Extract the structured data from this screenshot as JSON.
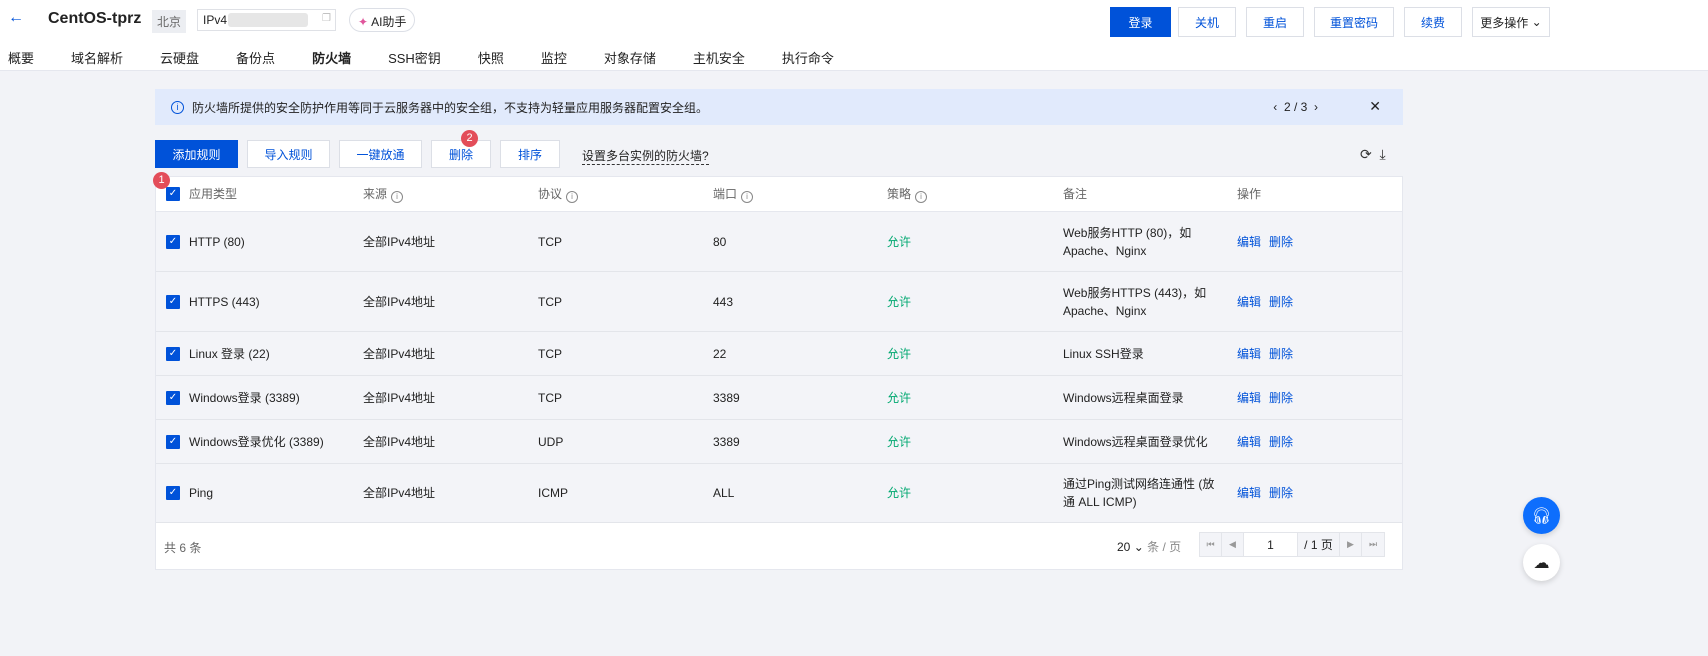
{
  "header": {
    "title": "CentOS-tprz",
    "region": "北京",
    "ip_label": "IPv4",
    "ai_label": "AI助手",
    "buttons": {
      "login": "登录",
      "shutdown": "关机",
      "restart": "重启",
      "reset_password": "重置密码",
      "renew": "续费",
      "more": "更多操作"
    }
  },
  "tabs": [
    "概要",
    "域名解析",
    "云硬盘",
    "备份点",
    "防火墙",
    "SSH密钥",
    "快照",
    "监控",
    "对象存储",
    "主机安全",
    "执行命令"
  ],
  "notice": {
    "text": "防火墙所提供的安全防护作用等同于云服务器中的安全组，不支持为轻量应用服务器配置安全组。",
    "pager": "2 / 3"
  },
  "toolbar": {
    "add": "添加规则",
    "import": "导入规则",
    "open_all": "一键放通",
    "delete": "删除",
    "sort": "排序",
    "multi_instance": "设置多台实例的防火墙?"
  },
  "badges": {
    "one": "1",
    "two": "2"
  },
  "table": {
    "headers": [
      "应用类型",
      "来源",
      "协议",
      "端口",
      "策略",
      "备注",
      "操作"
    ],
    "rows": [
      {
        "app": "HTTP (80)",
        "source": "全部IPv4地址",
        "protocol": "TCP",
        "port": "80",
        "policy": "允许",
        "note": "Web服务HTTP (80)，如 Apache、Nginx"
      },
      {
        "app": "HTTPS (443)",
        "source": "全部IPv4地址",
        "protocol": "TCP",
        "port": "443",
        "policy": "允许",
        "note": "Web服务HTTPS (443)，如 Apache、Nginx"
      },
      {
        "app": "Linux 登录 (22)",
        "source": "全部IPv4地址",
        "protocol": "TCP",
        "port": "22",
        "policy": "允许",
        "note": "Linux SSH登录"
      },
      {
        "app": "Windows登录 (3389)",
        "source": "全部IPv4地址",
        "protocol": "TCP",
        "port": "3389",
        "policy": "允许",
        "note": "Windows远程桌面登录"
      },
      {
        "app": "Windows登录优化 (3389)",
        "source": "全部IPv4地址",
        "protocol": "UDP",
        "port": "3389",
        "policy": "允许",
        "note": "Windows远程桌面登录优化"
      },
      {
        "app": "Ping",
        "source": "全部IPv4地址",
        "protocol": "ICMP",
        "port": "ALL",
        "policy": "允许",
        "note": "通过Ping测试网络连通性 (放通 ALL ICMP)"
      }
    ],
    "actions": {
      "edit": "编辑",
      "delete": "删除"
    }
  },
  "footer": {
    "total": "共 6 条",
    "page_size": "20",
    "per_page": "条 / 页",
    "current_page": "1",
    "total_pages": "/ 1 页"
  }
}
